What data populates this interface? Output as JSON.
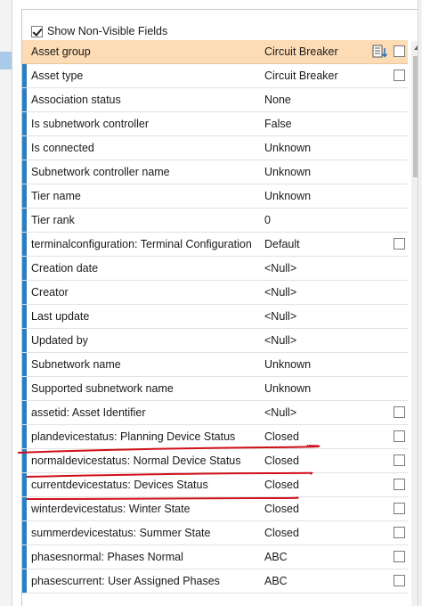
{
  "show_non_visible": {
    "label": "Show Non-Visible Fields",
    "checked": true
  },
  "header_row": {
    "field": "Asset group",
    "value": "Circuit Breaker"
  },
  "rows": [
    {
      "field": "Asset type",
      "value": "Circuit Breaker",
      "checkbox": true
    },
    {
      "field": "Association status",
      "value": "None",
      "checkbox": false
    },
    {
      "field": "Is subnetwork controller",
      "value": "False",
      "checkbox": false
    },
    {
      "field": "Is connected",
      "value": "Unknown",
      "checkbox": false
    },
    {
      "field": "Subnetwork controller name",
      "value": "Unknown",
      "checkbox": false
    },
    {
      "field": "Tier name",
      "value": "Unknown",
      "checkbox": false
    },
    {
      "field": "Tier rank",
      "value": "0",
      "checkbox": false
    },
    {
      "field": "terminalconfiguration: Terminal Configuration",
      "value": "Default",
      "checkbox": true
    },
    {
      "field": "Creation date",
      "value": "<Null>",
      "checkbox": false
    },
    {
      "field": "Creator",
      "value": "<Null>",
      "checkbox": false
    },
    {
      "field": "Last update",
      "value": "<Null>",
      "checkbox": false
    },
    {
      "field": "Updated by",
      "value": "<Null>",
      "checkbox": false
    },
    {
      "field": "Subnetwork name",
      "value": "Unknown",
      "checkbox": false
    },
    {
      "field": "Supported subnetwork name",
      "value": "Unknown",
      "checkbox": false
    },
    {
      "field": "assetid: Asset Identifier",
      "value": "<Null>",
      "checkbox": true
    },
    {
      "field": "plandevicestatus: Planning Device Status",
      "value": "Closed",
      "checkbox": true
    },
    {
      "field": "normaldevicestatus: Normal Device Status",
      "value": "Closed",
      "checkbox": true
    },
    {
      "field": "currentdevicestatus: Devices Status",
      "value": "Closed",
      "checkbox": true
    },
    {
      "field": "winterdevicestatus: Winter State",
      "value": "Closed",
      "checkbox": true
    },
    {
      "field": "summerdevicestatus: Summer State",
      "value": "Closed",
      "checkbox": true
    },
    {
      "field": "phasesnormal: Phases Normal",
      "value": "ABC",
      "checkbox": true
    },
    {
      "field": "phasescurrent: User Assigned Phases",
      "value": "ABC",
      "checkbox": true
    }
  ],
  "colors": {
    "header_bg": "#fddcb5",
    "row_indicator": "#2a7ec3",
    "annotation_red": "#d0101a"
  },
  "icons": {
    "header_fields_icon": "field-list-icon",
    "scroll_up": "chevron-up-icon"
  }
}
